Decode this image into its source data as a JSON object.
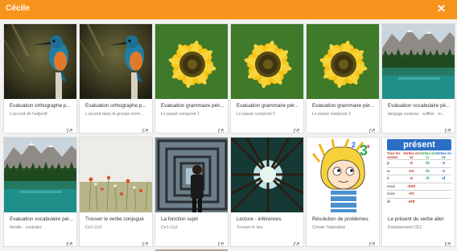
{
  "header": {
    "title": "Cécile",
    "close_symbol": "✕",
    "color": "#f7941d"
  },
  "cards": [
    {
      "title": "Évaluation orthographe p...",
      "subtitle": "L'accord de l'adjectif",
      "image": "kingfisher"
    },
    {
      "title": "Évaluation orthographe p...",
      "subtitle": "L'accord dans le groupe nomi...",
      "image": "kingfisher"
    },
    {
      "title": "Évaluation grammaire péri...",
      "subtitle": "Le passé composé 1",
      "image": "sunflower"
    },
    {
      "title": "Évaluation grammaire pér...",
      "subtitle": "Le passé composé 2",
      "image": "sunflower"
    },
    {
      "title": "Évaluation grammaire pér...",
      "subtitle": "Le passé composé 3",
      "image": "sunflower"
    },
    {
      "title": "Évaluation vocabulaire pé...",
      "subtitle": "langage soutenu - suffixe - m...",
      "image": "lake"
    },
    {
      "title": "Évaluation vocabulaire pér...",
      "subtitle": "famille - contraire",
      "image": "lake"
    },
    {
      "title": "Trouver le verbe conjugué",
      "subtitle": "Ce1-Ce2",
      "image": "flowers"
    },
    {
      "title": "La fonction sujet",
      "subtitle": "Ce1-Ce2",
      "image": "tunnel"
    },
    {
      "title": "Lecture - inférences",
      "subtitle": "Trouver le lieu",
      "image": "forest"
    },
    {
      "title": "Résolution de problèmes",
      "subtitle": "Choisir l'opération",
      "image": "cartoon"
    },
    {
      "title": "Le présent du verbe aller",
      "subtitle": "Entrainement CE1",
      "image": "present"
    }
  ],
  "present_chart": {
    "heading": "présent",
    "col_headers": [
      "Verbes en -er",
      "Verbes en -ir",
      "Verbes en -re"
    ],
    "row_label": "Tous les verbes",
    "rows": [
      {
        "pronoun": "je",
        "a": "-e",
        "b": "-is",
        "c": "-s"
      },
      {
        "pronoun": "tu",
        "a": "-es",
        "b": "-is",
        "c": "-s"
      },
      {
        "pronoun": "il",
        "a": "-e",
        "b": "-it",
        "c": "-d"
      },
      {
        "pronoun": "nous",
        "a": "-ons",
        "b": "",
        "c": ""
      },
      {
        "pronoun": "vous",
        "a": "-ez",
        "b": "",
        "c": ""
      },
      {
        "pronoun": "ils",
        "a": "-ent",
        "b": "",
        "c": ""
      }
    ]
  },
  "icons": {
    "close": "close-icon",
    "open": "open-in-new-icon"
  }
}
